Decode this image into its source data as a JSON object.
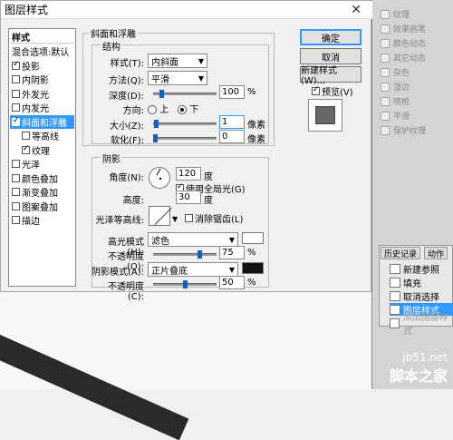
{
  "dialog": {
    "title": "图层样式"
  },
  "styles_panel": {
    "header": "样式",
    "items": [
      {
        "label": "混合选项:默认",
        "checkbox": false
      },
      {
        "label": "投影",
        "checkbox": true,
        "checked": true
      },
      {
        "label": "内阴影",
        "checkbox": true,
        "checked": false
      },
      {
        "label": "外发光",
        "checkbox": true,
        "checked": false
      },
      {
        "label": "内发光",
        "checkbox": true,
        "checked": false
      },
      {
        "label": "斜面和浮雕",
        "checkbox": true,
        "checked": true,
        "selected": true
      },
      {
        "label": "等高线",
        "checkbox": true,
        "checked": false,
        "sub": true
      },
      {
        "label": "纹理",
        "checkbox": true,
        "checked": true,
        "sub": true
      },
      {
        "label": "光泽",
        "checkbox": true,
        "checked": false
      },
      {
        "label": "颜色叠加",
        "checkbox": true,
        "checked": false
      },
      {
        "label": "渐变叠加",
        "checkbox": true,
        "checked": false
      },
      {
        "label": "图案叠加",
        "checkbox": true,
        "checked": false
      },
      {
        "label": "描边",
        "checkbox": true,
        "checked": false
      }
    ]
  },
  "bevel": {
    "group_title": "斜面和浮雕",
    "structure_title": "结构",
    "style_label": "样式(T):",
    "style_value": "内斜面",
    "method_label": "方法(Q):",
    "method_value": "平滑",
    "depth_label": "深度(D):",
    "depth_value": "100",
    "depth_unit": "%",
    "depth_level": 0.1,
    "direction_label": "方向:",
    "dir_up": "上",
    "dir_down": "下",
    "size_label": "大小(Z):",
    "size_value": "1",
    "size_unit": "像素",
    "size_level": 0.02,
    "soften_label": "软化(F):",
    "soften_value": "0",
    "soften_unit": "像素",
    "soften_level": 0.0
  },
  "shading": {
    "title": "阴影",
    "angle_label": "角度(N):",
    "angle_value": "120",
    "angle_unit": "度",
    "global_light_label": "使用全局光(G)",
    "altitude_label": "高度:",
    "altitude_value": "30",
    "altitude_unit": "度",
    "gloss_label": "光泽等高线:",
    "antialias_label": "消除锯齿(L)",
    "highlight_label": "高光模式(H):",
    "highlight_value": "滤色",
    "highlight_color": "#ffffff",
    "opacity1_label": "不透明度(O):",
    "opacity1_value": "75",
    "opacity1_unit": "%",
    "opacity1_level": 0.75,
    "shadow_label": "阴影模式(A):",
    "shadow_value": "正片叠底",
    "shadow_color": "#111111",
    "opacity2_label": "不透明度(C):",
    "opacity2_value": "50",
    "opacity2_unit": "%",
    "opacity2_level": 0.5
  },
  "buttons": {
    "ok": "确定",
    "cancel": "取消",
    "new_style": "新建样式(W)...",
    "preview": "预览(V)"
  },
  "right_panel": {
    "items": [
      "纹理",
      "效果画笔",
      "颜色动态",
      "其它动态",
      "杂色",
      "湿边",
      "喷枪",
      "平滑",
      "保护纹理"
    ]
  },
  "history": {
    "tab1": "历史记录",
    "tab2": "动作",
    "items": [
      "新建参照",
      "填充",
      "取消选择",
      "图层样式",
      "添加图层样式"
    ]
  },
  "watermark": {
    "line1": "jb51.net",
    "line2": "脚本之家"
  }
}
